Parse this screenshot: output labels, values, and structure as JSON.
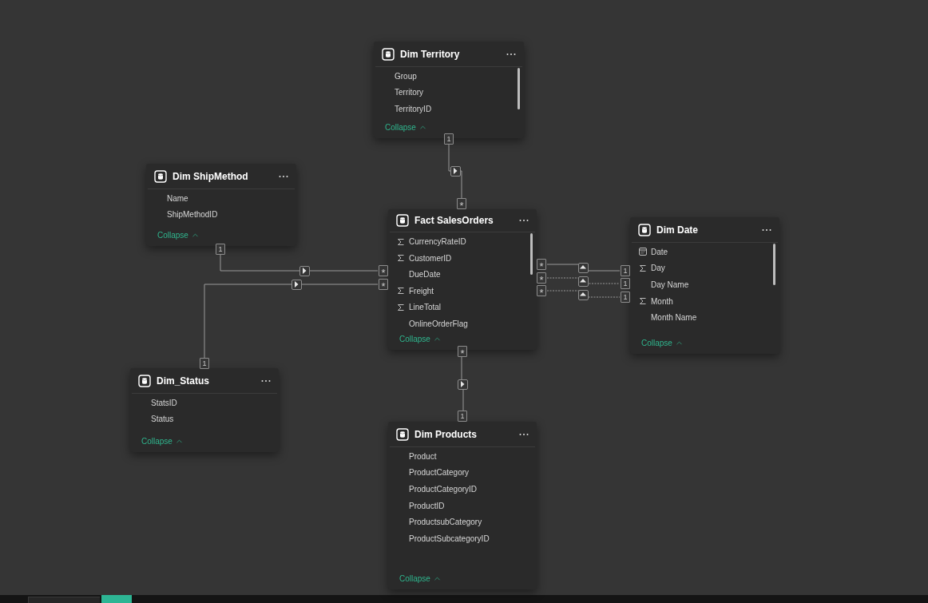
{
  "tables": [
    {
      "title": "Dim Territory",
      "scrollable": true,
      "fields": [
        {
          "name": "Group",
          "kind": "plain"
        },
        {
          "name": "Territory",
          "kind": "plain"
        },
        {
          "name": "TerritoryID",
          "kind": "plain"
        }
      ],
      "collapse": "Collapse"
    },
    {
      "title": "Dim ShipMethod",
      "scrollable": false,
      "fields": [
        {
          "name": "Name",
          "kind": "plain"
        },
        {
          "name": "ShipMethodID",
          "kind": "plain"
        }
      ],
      "collapse": "Collapse"
    },
    {
      "title": "Fact SalesOrders",
      "scrollable": true,
      "fields": [
        {
          "name": "CurrencyRateID",
          "kind": "sum"
        },
        {
          "name": "CustomerID",
          "kind": "sum"
        },
        {
          "name": "DueDate",
          "kind": "plain"
        },
        {
          "name": "Freight",
          "kind": "sum"
        },
        {
          "name": "LineTotal",
          "kind": "sum"
        },
        {
          "name": "OnlineOrderFlag",
          "kind": "plain"
        }
      ],
      "collapse": "Collapse"
    },
    {
      "title": "Dim Date",
      "scrollable": true,
      "fields": [
        {
          "name": "Date",
          "kind": "date"
        },
        {
          "name": "Day",
          "kind": "sum"
        },
        {
          "name": "Day Name",
          "kind": "plain"
        },
        {
          "name": "Month",
          "kind": "sum"
        },
        {
          "name": "Month Name",
          "kind": "plain"
        }
      ],
      "collapse": "Collapse"
    },
    {
      "title": "Dim_Status",
      "scrollable": false,
      "fields": [
        {
          "name": "StatsID",
          "kind": "plain"
        },
        {
          "name": "Status",
          "kind": "plain"
        }
      ],
      "collapse": "Collapse"
    },
    {
      "title": "Dim Products",
      "scrollable": false,
      "fields": [
        {
          "name": "Product",
          "kind": "plain"
        },
        {
          "name": "ProductCategory",
          "kind": "plain"
        },
        {
          "name": "ProductCategoryID",
          "kind": "plain"
        },
        {
          "name": "ProductID",
          "kind": "plain"
        },
        {
          "name": "ProductsubCategory",
          "kind": "plain"
        },
        {
          "name": "ProductSubcategoryID",
          "kind": "plain"
        }
      ],
      "collapse": "Collapse"
    }
  ],
  "relationships": [
    {
      "one_end": "1",
      "many_end": "*",
      "dashed": false
    },
    {
      "one_end": "1",
      "many_end": "*",
      "dashed": false
    },
    {
      "one_end": "1",
      "many_end": "*",
      "dashed": false
    },
    {
      "one_end": "1",
      "many_end": "*",
      "dashed": false
    },
    {
      "one_end": "1",
      "many_end": "*",
      "dashed": true
    },
    {
      "one_end": "1",
      "many_end": "*",
      "dashed": true
    },
    {
      "one_end": "1",
      "many_end": "*",
      "dashed": false
    }
  ]
}
